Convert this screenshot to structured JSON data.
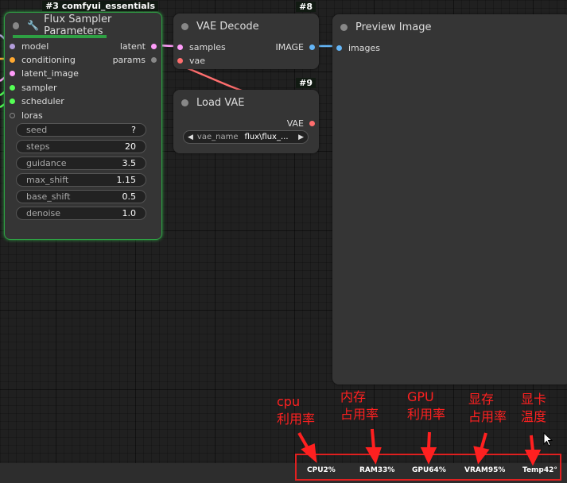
{
  "nodes": {
    "flux_sampler": {
      "id": "#3 comfyui_essentials",
      "title": "Flux Sampler Parameters",
      "inputs": [
        "model",
        "conditioning",
        "latent_image",
        "sampler",
        "scheduler",
        "loras"
      ],
      "outputs": [
        "latent",
        "params"
      ],
      "widgets": [
        {
          "label": "seed",
          "value": "?"
        },
        {
          "label": "steps",
          "value": "20"
        },
        {
          "label": "guidance",
          "value": "3.5"
        },
        {
          "label": "max_shift",
          "value": "1.15"
        },
        {
          "label": "base_shift",
          "value": "0.5"
        },
        {
          "label": "denoise",
          "value": "1.0"
        }
      ]
    },
    "vae_decode": {
      "id": "#8",
      "title": "VAE Decode",
      "inputs": [
        "samples",
        "vae"
      ],
      "outputs": [
        "IMAGE"
      ]
    },
    "load_vae": {
      "id": "#9",
      "title": "Load VAE",
      "outputs": [
        "VAE"
      ],
      "combo": {
        "label": "vae_name",
        "value": "flux\\flux_..."
      }
    },
    "preview_image": {
      "title": "Preview Image",
      "inputs": [
        "images"
      ]
    }
  },
  "stats": {
    "cpu": "CPU2%",
    "ram": "RAM33%",
    "gpu": "GPU64%",
    "vram": "VRAM95%",
    "temp": "Temp42°"
  },
  "annotations": {
    "cpu": [
      "cpu",
      "利用率"
    ],
    "ram": [
      "内存",
      "占用率"
    ],
    "gpu": [
      "GPU",
      "利用率"
    ],
    "vram": [
      "显存",
      "占用率"
    ],
    "temp": [
      "显卡",
      "温度"
    ]
  },
  "colors": {
    "accent_green": "#2ea043",
    "model": "#b39ddb",
    "conditioning": "#ffa931",
    "latent": "#ff9cf9",
    "sampler": "#55ff55",
    "vae": "#ff6e6e",
    "image": "#64b5f6",
    "annotation_red": "#ff2020"
  }
}
